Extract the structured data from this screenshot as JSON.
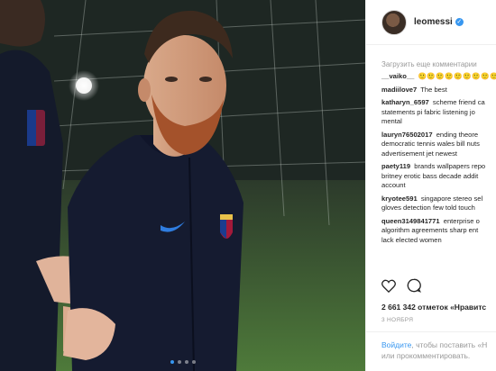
{
  "post": {
    "username": "leomessi",
    "verified_icon": "verified-badge-icon",
    "load_more_comments": "Загрузить еще комментарии",
    "comments": [
      {
        "author": "__vaiko__",
        "text": "",
        "emoji": "🙂🙂🙂🙂🙂🙂🙂🙂🙂🙂",
        "extra_lines": []
      },
      {
        "author": "madiilove7",
        "text": "The best",
        "extra_lines": []
      },
      {
        "author": "katharyn_6597",
        "text": "scheme friend ca",
        "extra_lines": [
          "statements pi fabric listening jo",
          "mental"
        ]
      },
      {
        "author": "lauryn76502017",
        "text": "ending theore",
        "extra_lines": [
          "democratic tennis wales bill nuts",
          "advertisement jet newest"
        ]
      },
      {
        "author": "paety119",
        "text": "brands wallpapers repo",
        "extra_lines": [
          "britney erotic bass decade addit",
          "account"
        ]
      },
      {
        "author": "kryotee591",
        "text": "singapore stereo sel",
        "extra_lines": [
          "gloves detection few told touch"
        ]
      },
      {
        "author": "queen3149841771",
        "text": "enterprise o",
        "extra_lines": [
          "algorithm agreements sharp ent",
          "lack elected women"
        ]
      }
    ],
    "likes": "2 661 342 отметок «Нравитс",
    "date": "3 ноября",
    "login_link": "Войдите",
    "login_text": ", чтобы поставить «Н",
    "login_text_2": "или прокомментировать."
  },
  "carousel": {
    "count": 4,
    "active": 1
  },
  "colors": {
    "accent": "#3897f0",
    "muted": "#999999",
    "border": "#efefef"
  }
}
